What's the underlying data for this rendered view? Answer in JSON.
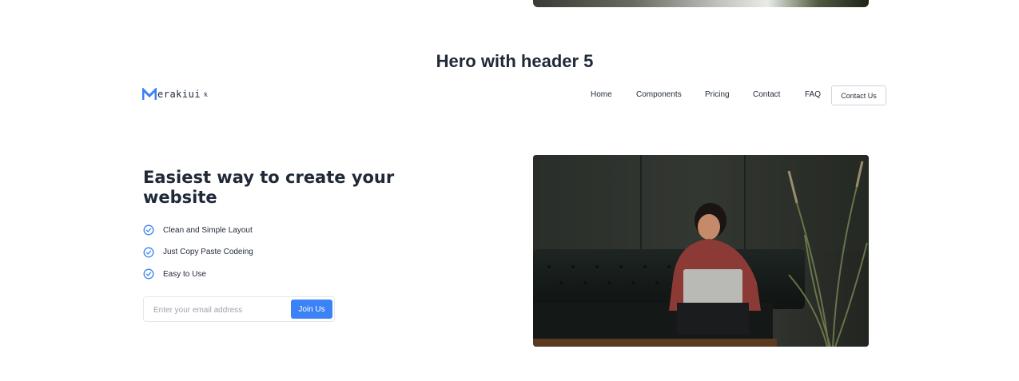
{
  "section": {
    "title": "Hero with header 5"
  },
  "logo": {
    "brand": "erakiui",
    "suffix": "k"
  },
  "nav": {
    "items": [
      {
        "label": "Home"
      },
      {
        "label": "Components"
      },
      {
        "label": "Pricing"
      },
      {
        "label": "Contact"
      },
      {
        "label": "FAQ"
      }
    ],
    "cta_label": "Contact Us"
  },
  "hero": {
    "title": "Easiest way to create your website",
    "features": [
      {
        "label": "Clean and Simple Layout"
      },
      {
        "label": "Just Copy Paste Codeing"
      },
      {
        "label": "Easy to Use"
      }
    ],
    "email_placeholder": "Enter your email address",
    "email_value": "",
    "join_label": "Join Us"
  },
  "icons": {
    "check": "check-circle-icon",
    "logo": "merakiui-logo-icon"
  },
  "colors": {
    "accent": "#3b82f6",
    "text": "#1f2937",
    "placeholder": "#9ca3af",
    "border": "#e5e7eb"
  }
}
